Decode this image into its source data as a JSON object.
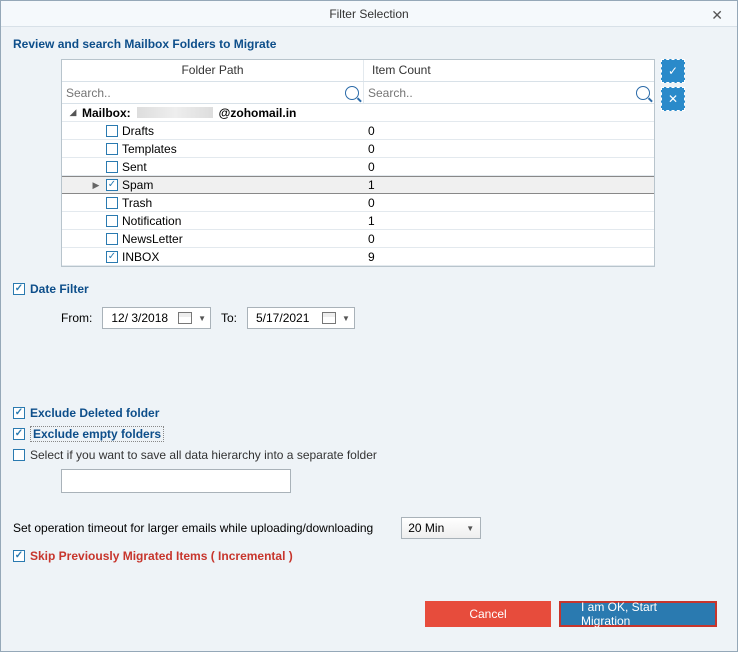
{
  "title": "Filter Selection",
  "heading": "Review and search Mailbox Folders to Migrate",
  "grid": {
    "col_folder": "Folder Path",
    "col_count": "Item Count",
    "search_placeholder": "Search..",
    "mailbox_prefix": "Mailbox:",
    "mailbox_suffix": "@zohomail.in",
    "rows": [
      {
        "label": "Drafts",
        "count": "0",
        "checked": false
      },
      {
        "label": "Templates",
        "count": "0",
        "checked": false
      },
      {
        "label": "Sent",
        "count": "0",
        "checked": false
      },
      {
        "label": "Spam",
        "count": "1",
        "checked": true,
        "selected": true
      },
      {
        "label": "Trash",
        "count": "0",
        "checked": false
      },
      {
        "label": "Notification",
        "count": "1",
        "checked": false
      },
      {
        "label": "NewsLetter",
        "count": "0",
        "checked": false
      },
      {
        "label": "INBOX",
        "count": "9",
        "checked": true
      }
    ]
  },
  "options": {
    "date_filter": "Date Filter",
    "from_label": "From:",
    "to_label": "To:",
    "from_value": "12/ 3/2018",
    "to_value": "5/17/2021",
    "exclude_deleted": "Exclude Deleted folder",
    "exclude_empty": "Exclude empty folders",
    "save_hierarchy": "Select if you want to save all data hierarchy into a separate folder",
    "hierarchy_path": "",
    "timeout_label": "Set operation timeout for larger emails while uploading/downloading",
    "timeout_value": "20 Min",
    "skip_migrated": "Skip Previously Migrated Items ( Incremental )"
  },
  "buttons": {
    "cancel": "Cancel",
    "start": "I am OK, Start Migration"
  }
}
